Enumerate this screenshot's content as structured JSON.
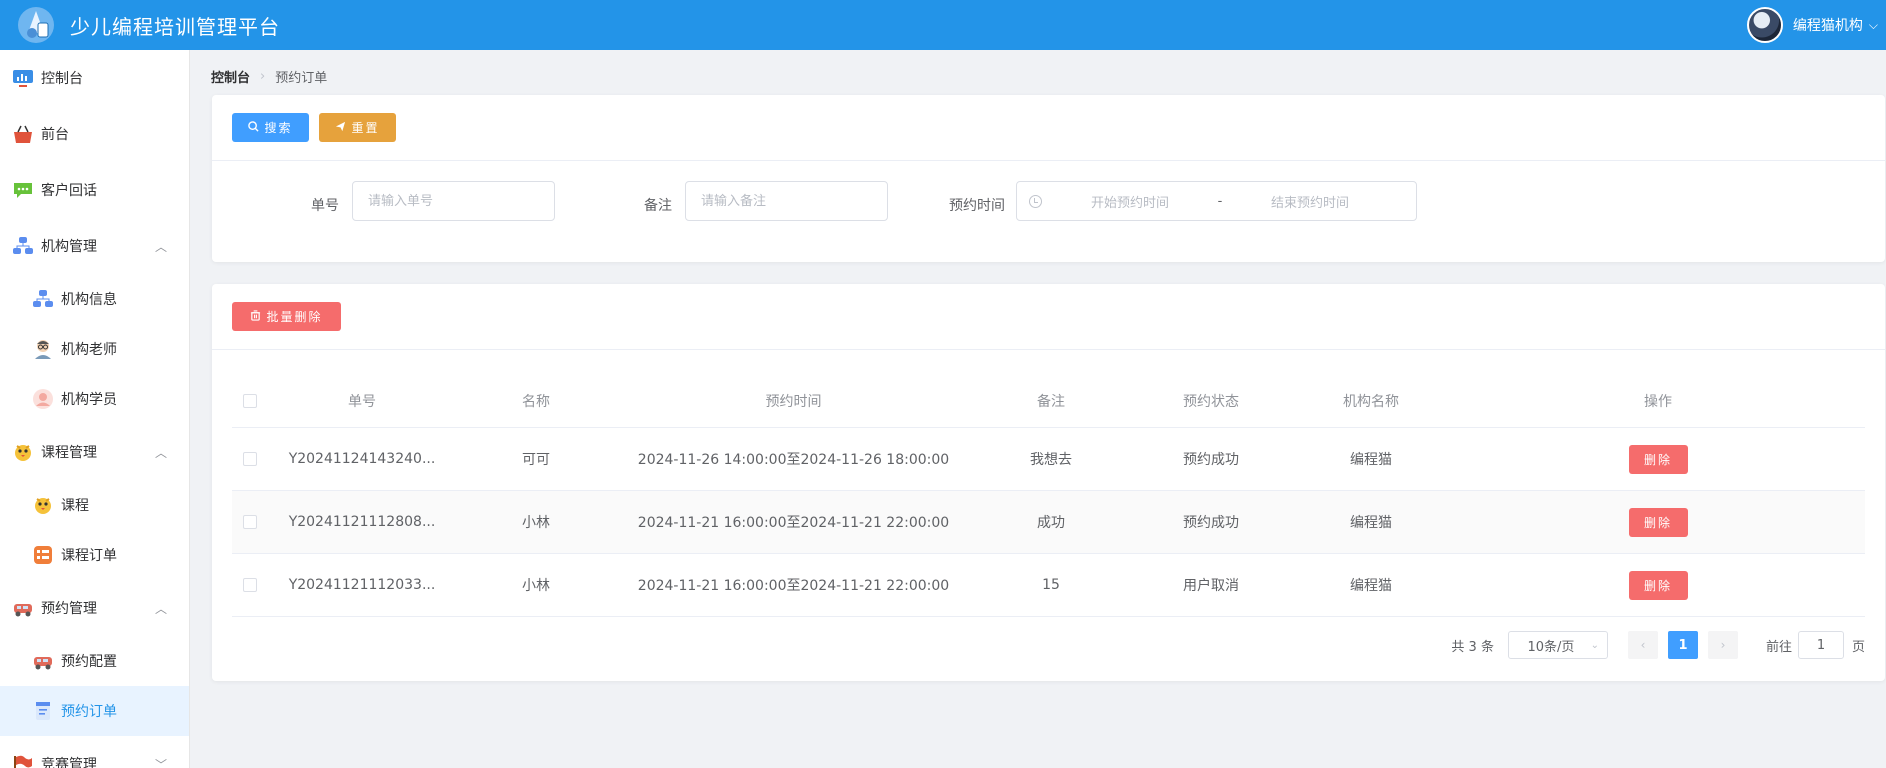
{
  "header": {
    "title": "少儿编程培训管理平台",
    "user_name": "编程猫机构",
    "caret": "⌵"
  },
  "sidebar": {
    "items": [
      {
        "label": "控制台",
        "icon": "monitor-icon",
        "color": "#3a8ee6"
      },
      {
        "label": "前台",
        "icon": "basket-icon",
        "color": "#e0533b"
      },
      {
        "label": "客户回话",
        "icon": "chat-icon",
        "color": "#67c23a"
      },
      {
        "label": "机构管理",
        "icon": "org-chart-icon",
        "color": "#5b8def",
        "arrow": "︿"
      },
      {
        "label": "机构信息",
        "icon": "org-chart-icon",
        "color": "#5b8def"
      },
      {
        "label": "机构老师",
        "icon": "teacher-icon",
        "color": "#7a9ab8"
      },
      {
        "label": "机构学员",
        "icon": "student-icon",
        "color": "#f3a9a0"
      },
      {
        "label": "课程管理",
        "icon": "chick-icon",
        "color": "#f5c23a",
        "arrow": "︿"
      },
      {
        "label": "课程",
        "icon": "chick-icon",
        "color": "#f5c23a"
      },
      {
        "label": "课程订单",
        "icon": "order-list-icon",
        "color": "#f07e3a"
      },
      {
        "label": "预约管理",
        "icon": "car-icon",
        "color": "#e06a5a",
        "arrow": "︿"
      },
      {
        "label": "预约配置",
        "icon": "car-icon",
        "color": "#e06a5a"
      },
      {
        "label": "预约订单",
        "icon": "document-icon",
        "color": "#5b8def"
      },
      {
        "label": "竞赛管理",
        "icon": "flag-icon",
        "color": "#e0533b",
        "arrow": "﹀"
      }
    ]
  },
  "breadcrumb": {
    "home": "控制台",
    "separator": "›",
    "current": "预约订单"
  },
  "search": {
    "search_label": "搜索",
    "reset_label": "重置",
    "order_no_label": "单号",
    "order_no_placeholder": "请输入单号",
    "note_label": "备注",
    "note_placeholder": "请输入备注",
    "time_label": "预约时间",
    "start_placeholder": "开始预约时间",
    "range_separator": "-",
    "end_placeholder": "结束预约时间"
  },
  "table": {
    "batch_delete_label": "批量删除",
    "columns": [
      "单号",
      "名称",
      "预约时间",
      "备注",
      "预约状态",
      "机构名称",
      "操作"
    ],
    "rows": [
      {
        "order_no": "Y20241124143240...",
        "name": "可可",
        "time": "2024-11-26 14:00:00至2024-11-26 18:00:00",
        "note": "我想去",
        "status": "预约成功",
        "org": "编程猫",
        "action": "删除"
      },
      {
        "order_no": "Y20241121112808...",
        "name": "小林",
        "time": "2024-11-21 16:00:00至2024-11-21 22:00:00",
        "note": "成功",
        "status": "预约成功",
        "org": "编程猫",
        "action": "删除"
      },
      {
        "order_no": "Y20241121112033...",
        "name": "小林",
        "time": "2024-11-21 16:00:00至2024-11-21 22:00:00",
        "note": "15",
        "status": "用户取消",
        "org": "编程猫",
        "action": "删除"
      }
    ]
  },
  "pagination": {
    "total": "共 3 条",
    "page_size": "10条/页",
    "current_page": "1",
    "goto_prefix": "前往",
    "goto_value": "1",
    "goto_suffix": "页"
  },
  "colors": {
    "header": "#2394e8",
    "primary": "#409eff",
    "warning": "#e6a23c",
    "danger": "#f56c6c"
  }
}
